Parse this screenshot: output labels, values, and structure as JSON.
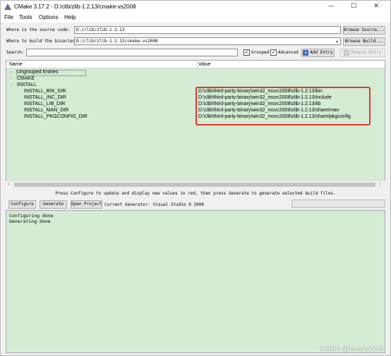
{
  "window": {
    "title": "CMake 3.17.2 - D:/clib/zlib-1.2.13/cmake-vs2008",
    "min_glyph": "—",
    "max_glyph": "☐",
    "close_glyph": "✕"
  },
  "menu": [
    "File",
    "Tools",
    "Options",
    "Help"
  ],
  "source": {
    "label": "Where is the source code:",
    "value": "D:/clib/zlib-1.2.13",
    "browse_label": "Browse Source..."
  },
  "binaries": {
    "label": "Where to build the binaries:",
    "value": "D:/clib/zlib-1.2.13/cmake-vs2008",
    "browse_label": "Browse Build..."
  },
  "search": {
    "label": "Search:",
    "value": "",
    "grouped_label": "Grouped",
    "grouped_checked": "✓",
    "advanced_label": "Advanced",
    "advanced_checked": "✓",
    "add_entry_label": "Add Entry",
    "remove_entry_label": "Remove Entry"
  },
  "table": {
    "headers": {
      "name": "Name",
      "value": "Value"
    },
    "groups": [
      {
        "arrow": "›",
        "name": "Ungrouped Entries"
      },
      {
        "arrow": "›",
        "name": "CMAKE"
      },
      {
        "arrow": "⌄",
        "name": "INSTALL"
      }
    ],
    "rows": [
      {
        "name": "INSTALL_BIN_DIR",
        "value": "D:\\clib\\third-party-binary\\win32_msvc2008\\zlib-1.2.13/bin"
      },
      {
        "name": "INSTALL_INC_DIR",
        "value": "D:\\clib\\third-party-binary\\win32_msvc2008\\zlib-1.2.13/include"
      },
      {
        "name": "INSTALL_LIB_DIR",
        "value": "D:\\clib\\third-party-binary\\win32_msvc2008\\zlib-1.2.13/lib"
      },
      {
        "name": "INSTALL_MAN_DIR",
        "value": "D:\\clib\\third-party-binary\\win32_msvc2008\\zlib-1.2.13/share/man"
      },
      {
        "name": "INSTALL_PKGCONFIG_DIR",
        "value": "D:\\clib\\third-party-binary\\win32_msvc2008\\zlib-1.2.13/share/pkgconfig"
      }
    ],
    "scroll_left": "‹",
    "scroll_right": "›"
  },
  "status_message": "Press Configure to update and display new values in red, then press Generate to generate selected build files.",
  "actions": {
    "configure_label": "Configure",
    "generate_label": "Generate",
    "open_project_label": "Open Project",
    "generator_text": "Current Generator: Visual Studio 9 2008"
  },
  "output": {
    "lines": [
      "Configuring done",
      "Generating done"
    ]
  },
  "watermark": "CSDN @binary0006",
  "colors": {
    "table_bg": "#d3ecd3",
    "highlight_border": "#e0362c",
    "add_badge": "#3b66c4"
  }
}
